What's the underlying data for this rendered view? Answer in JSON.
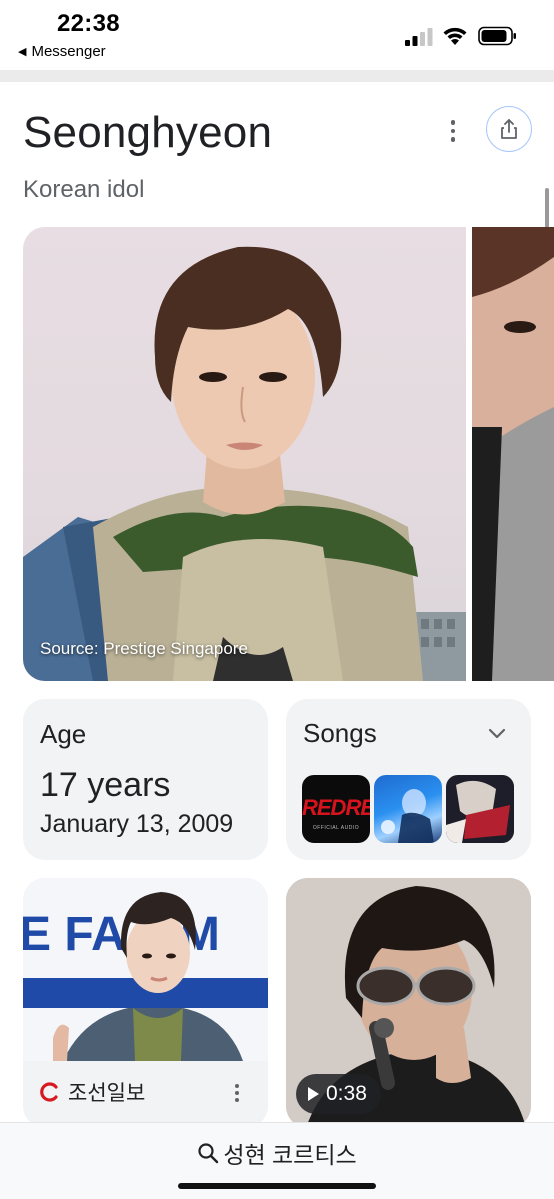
{
  "status_bar": {
    "time": "22:38",
    "back_app": "Messenger"
  },
  "header": {
    "title": "Seonghyeon",
    "subtitle": "Korean idol"
  },
  "photos": {
    "source_caption": "Source: Prestige Singapore"
  },
  "age_card": {
    "label": "Age",
    "years": "17 years",
    "birthdate": "January 13, 2009"
  },
  "songs_card": {
    "label": "Songs",
    "thumb1_text": "REDRE",
    "thumb1_sub": "OFFICIAL AUDIO"
  },
  "news_card": {
    "source": "조선일보",
    "banner_text": "E FA T M"
  },
  "video_card": {
    "duration": "0:38"
  },
  "bottom_search": {
    "query": "성현 코르티스"
  },
  "colors": {
    "accent_blue": "#a8c7fa",
    "card_bg": "#f1f3f4",
    "chosun_red": "#d71921"
  }
}
